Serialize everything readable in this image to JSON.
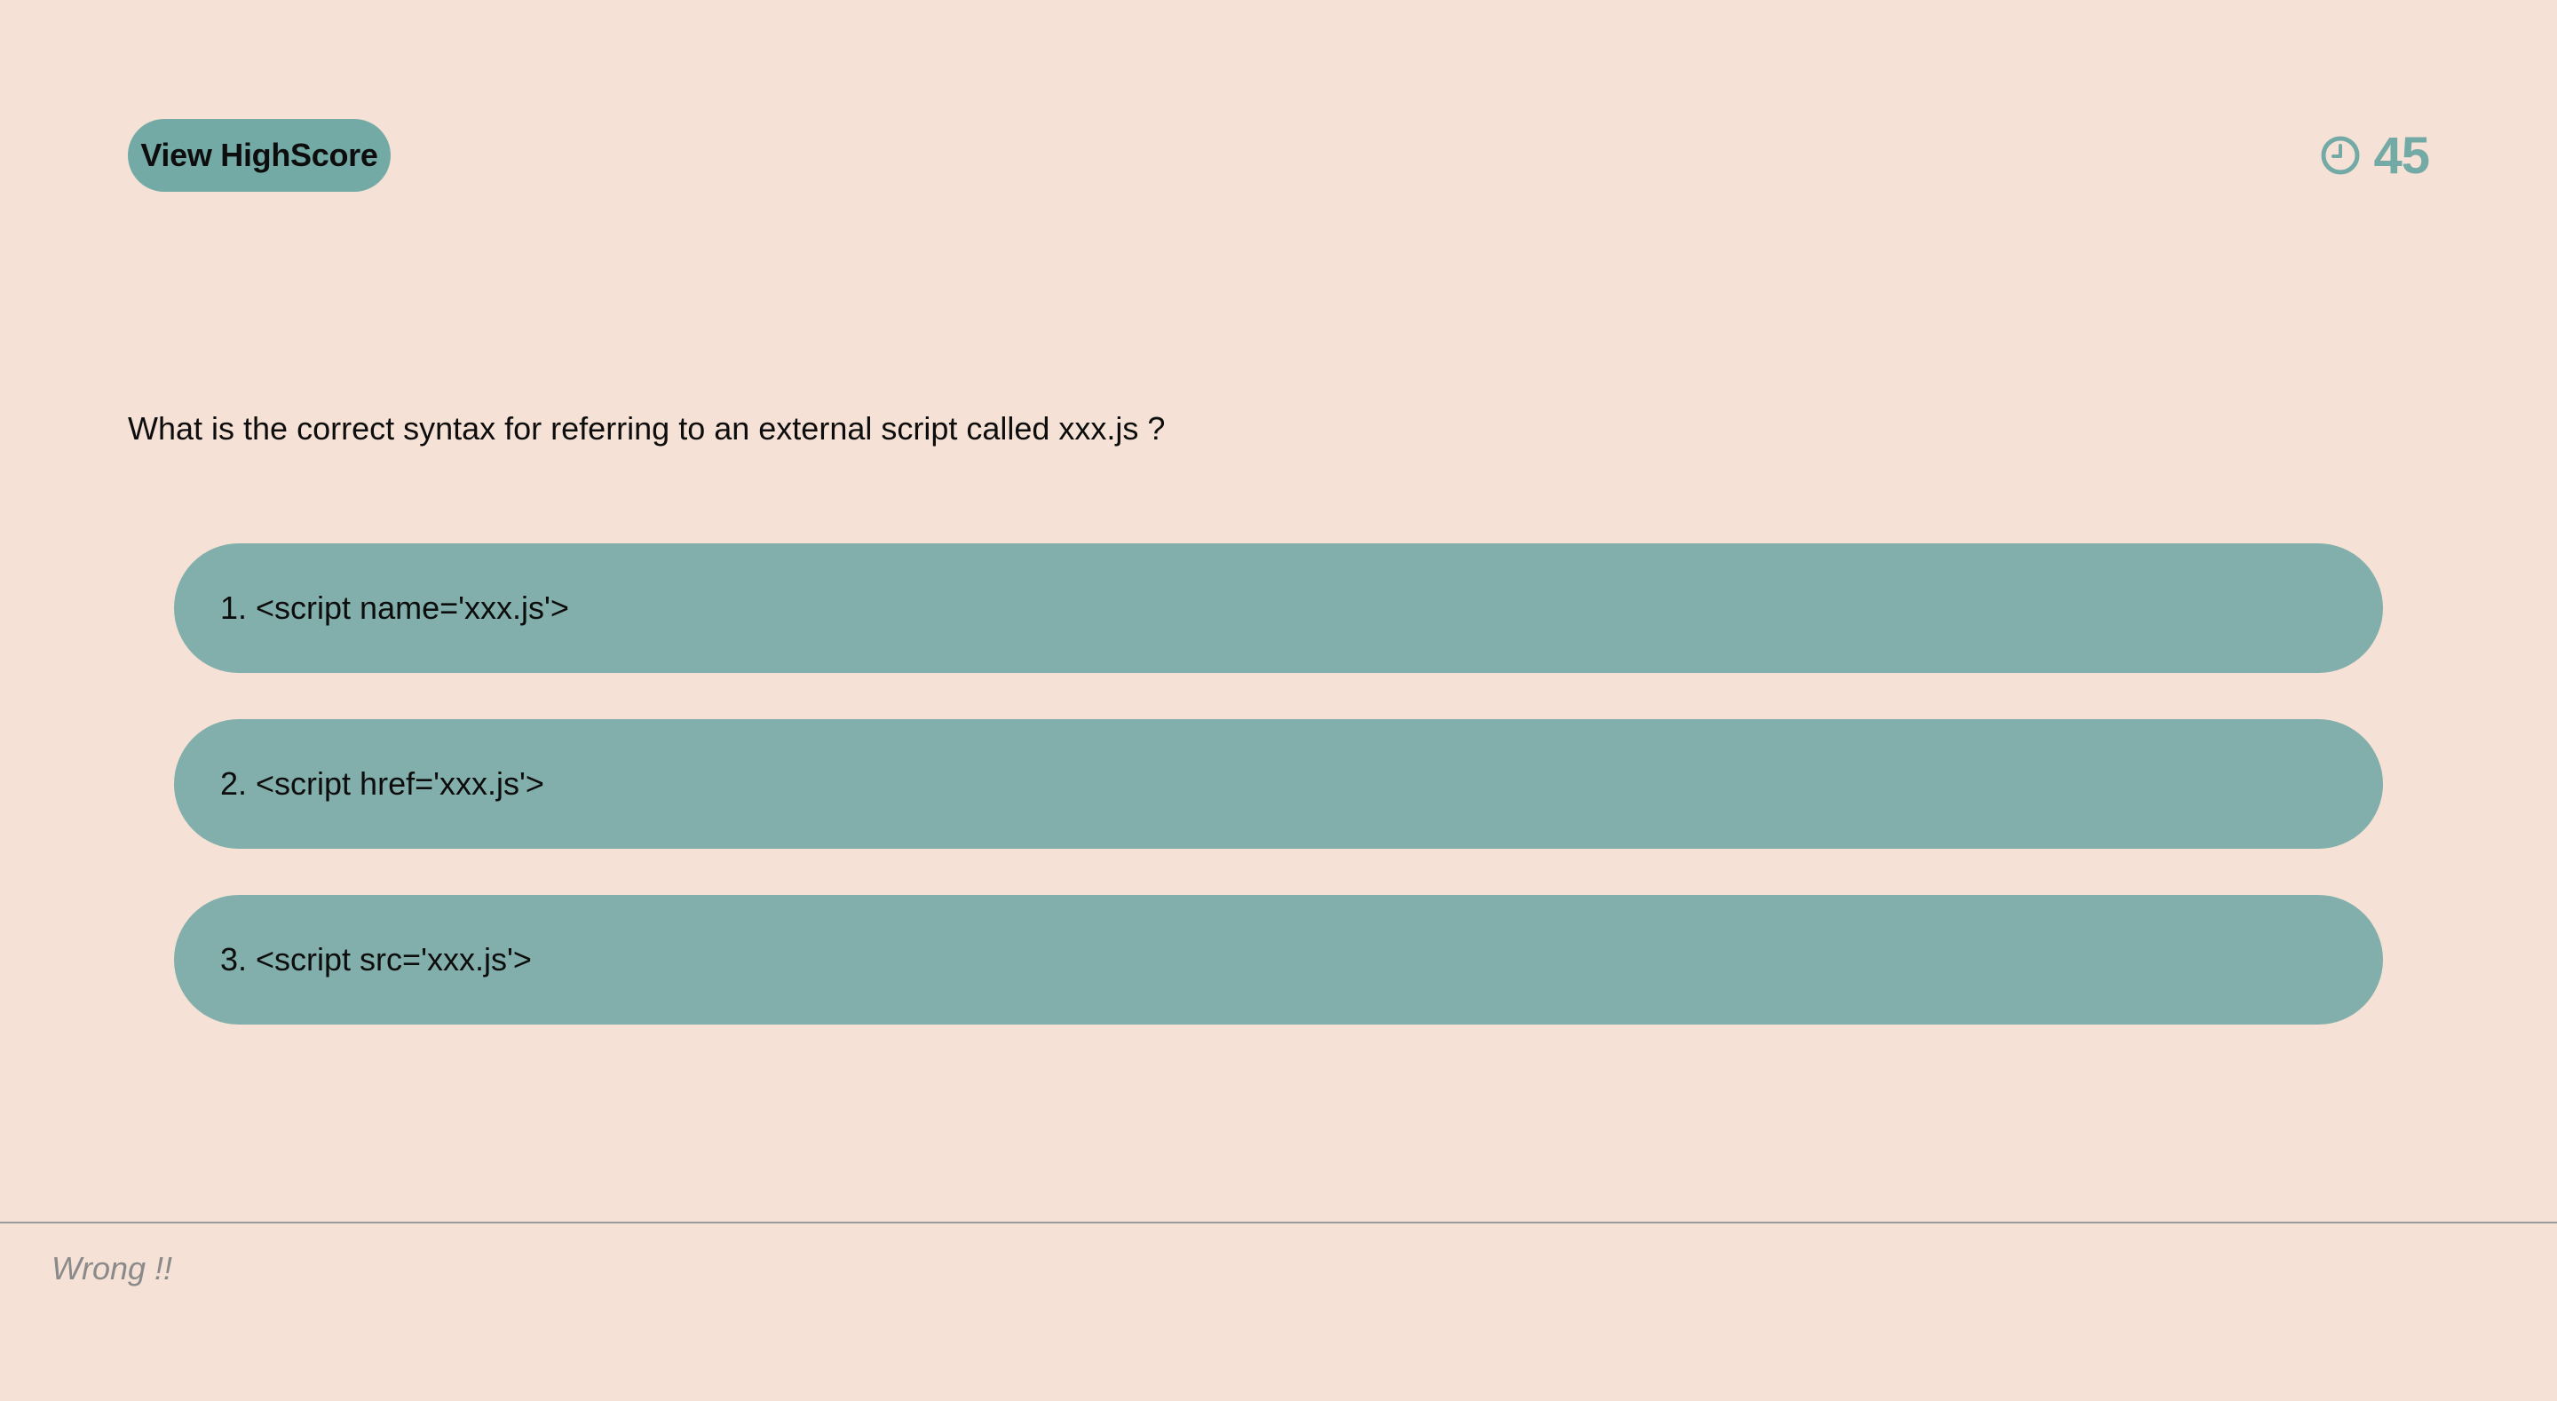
{
  "header": {
    "highscore_label": "View HighScore",
    "timer_icon": "clock-icon",
    "timer_value": "45"
  },
  "quiz": {
    "question": "What is the correct syntax for referring to an external script called xxx.js ?",
    "choices": [
      {
        "label": "1. <script name='xxx.js'>"
      },
      {
        "label": "2. <script href='xxx.js'>"
      },
      {
        "label": "3. <script src='xxx.js'>"
      }
    ]
  },
  "feedback": {
    "message": "Wrong !!"
  },
  "colors": {
    "background": "#f5e1d5",
    "accent": "#74aaa6",
    "choice_bg": "#82afab",
    "feedback_text": "#8a8a8a"
  }
}
